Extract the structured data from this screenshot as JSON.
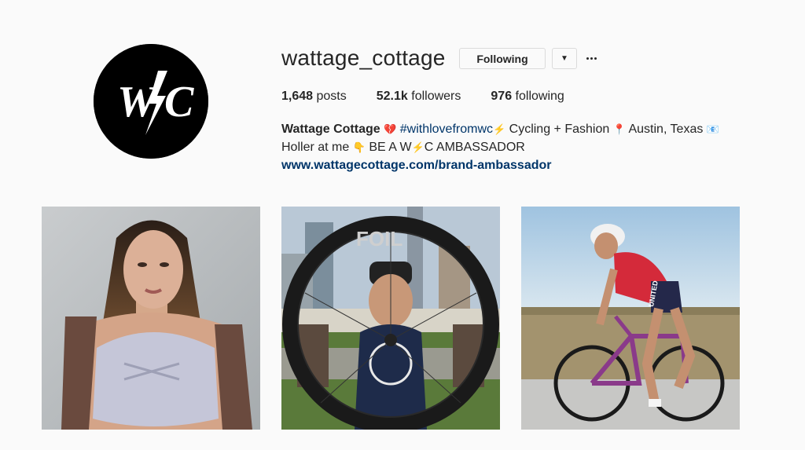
{
  "profile": {
    "username": "wattage_cottage",
    "avatar_text": "W/C",
    "following_label": "Following",
    "dropdown_icon": "caret-down-icon",
    "more_icon": "ellipsis-icon"
  },
  "stats": {
    "posts_count": "1,648",
    "posts_label": "posts",
    "followers_count": "52.1k",
    "followers_label": "followers",
    "following_count": "976",
    "following_label": "following"
  },
  "bio": {
    "name": "Wattage Cottage",
    "emoji_heart": "💔",
    "hashtag": "#withlovefromwc",
    "emoji_bolt": "⚡",
    "text1": "Cycling + Fashion",
    "emoji_pin": "📍",
    "location": "Austin, Texas",
    "emoji_mail": "📧",
    "line2_start": "Holler at me",
    "emoji_point": "👇",
    "ambassador_a": "BE A W",
    "ambassador_b": "C AMBASSADOR",
    "website": "www.wattagecottage.com/brand-ambassador"
  },
  "posts": [
    {
      "id": "post-1",
      "subject": "portrait-woman"
    },
    {
      "id": "post-2",
      "subject": "woman-holding-wheel"
    },
    {
      "id": "post-3",
      "subject": "cyclist-on-bike"
    }
  ],
  "wheel_text": "FOIL",
  "jersey_text": "UNITED",
  "colors": {
    "text": "#262626",
    "link": "#003569",
    "border": "#dbdbdb",
    "background": "#fafafa"
  }
}
